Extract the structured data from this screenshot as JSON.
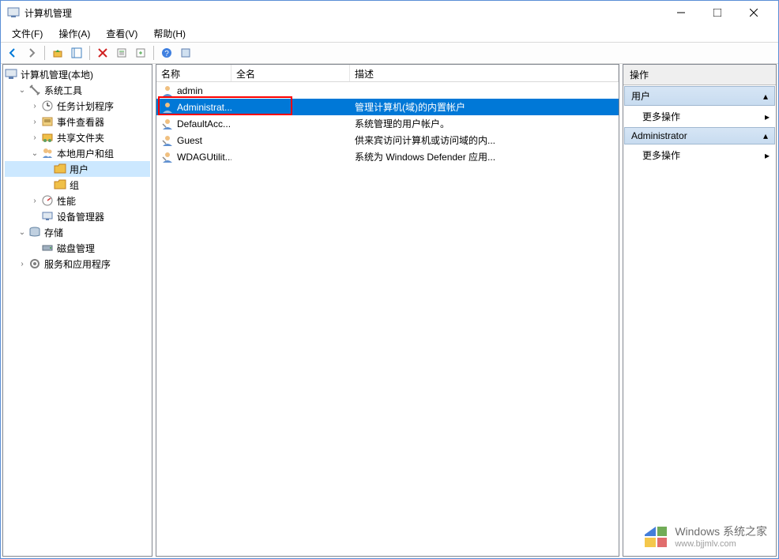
{
  "window": {
    "title": "计算机管理"
  },
  "menu": {
    "file": "文件(F)",
    "action": "操作(A)",
    "view": "查看(V)",
    "help": "帮助(H)"
  },
  "tree": {
    "root": "计算机管理(本地)",
    "system_tools": "系统工具",
    "task_scheduler": "任务计划程序",
    "event_viewer": "事件查看器",
    "shared_folders": "共享文件夹",
    "local_users_groups": "本地用户和组",
    "users": "用户",
    "groups": "组",
    "performance": "性能",
    "device_manager": "设备管理器",
    "storage": "存储",
    "disk_management": "磁盘管理",
    "services_apps": "服务和应用程序"
  },
  "list": {
    "headers": {
      "name": "名称",
      "fullname": "全名",
      "desc": "描述"
    },
    "rows": [
      {
        "name": "admin",
        "fullname": "",
        "desc": ""
      },
      {
        "name": "Administrat...",
        "fullname": "",
        "desc": "管理计算机(域)的内置帐户"
      },
      {
        "name": "DefaultAcc...",
        "fullname": "",
        "desc": "系统管理的用户帐户。"
      },
      {
        "name": "Guest",
        "fullname": "",
        "desc": "供来宾访问计算机或访问域的内..."
      },
      {
        "name": "WDAGUtilit...",
        "fullname": "",
        "desc": "系统为 Windows Defender 应用..."
      }
    ]
  },
  "actions": {
    "header": "操作",
    "section1": "用户",
    "more1": "更多操作",
    "section2": "Administrator",
    "more2": "更多操作"
  },
  "watermark": {
    "brand": "Windows 系统之家",
    "url": "www.bjjmlv.com"
  }
}
